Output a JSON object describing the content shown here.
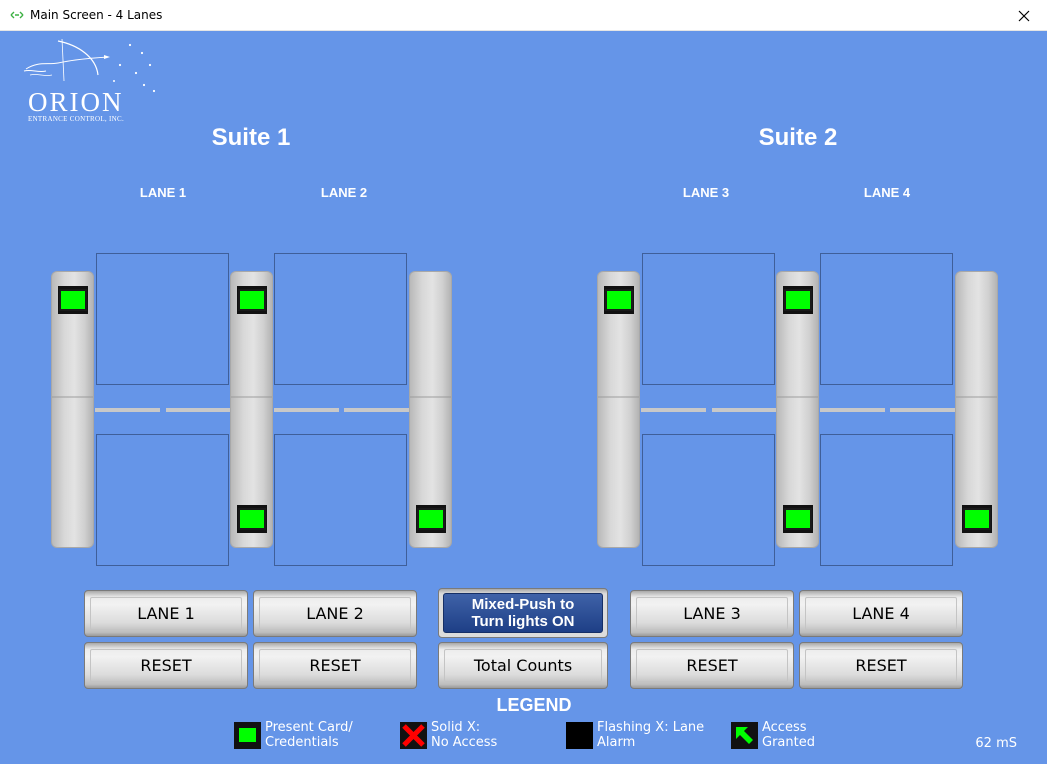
{
  "window": {
    "title": "Main Screen - 4 Lanes",
    "icon": "app-arrows-icon",
    "close_icon": "close-icon"
  },
  "logo": {
    "name": "ORION",
    "subtitle": "ENTRANCE CONTROL, INC."
  },
  "suites": [
    {
      "title": "Suite 1",
      "lanes": [
        "LANE 1",
        "LANE 2"
      ]
    },
    {
      "title": "Suite 2",
      "lanes": [
        "LANE 3",
        "LANE 4"
      ]
    }
  ],
  "indicator_color": "#00ff00",
  "buttons": {
    "lane1": "LANE 1",
    "lane2": "LANE 2",
    "lane3": "LANE 3",
    "lane4": "LANE 4",
    "reset1": "RESET",
    "reset2": "RESET",
    "reset3": "RESET",
    "reset4": "RESET",
    "mixed_push_line1": "Mixed-Push to",
    "mixed_push_line2": "Turn lights ON",
    "total_counts": "Total Counts"
  },
  "legend": {
    "title": "LEGEND",
    "items": [
      {
        "icon": "green-card-icon",
        "line1": "Present Card/",
        "line2": "Credentials"
      },
      {
        "icon": "red-x-icon",
        "line1": "Solid X:",
        "line2": "No Access"
      },
      {
        "icon": "black-square-icon",
        "line1": "Flashing X: Lane",
        "line2": "Alarm"
      },
      {
        "icon": "green-arrow-icon",
        "line1": "Access",
        "line2": "Granted"
      }
    ]
  },
  "status": {
    "timing": "62 mS"
  },
  "colors": {
    "background": "#6595e8",
    "button_blue": "#1e3f86",
    "green": "#00ff00",
    "red": "#ff0000"
  }
}
